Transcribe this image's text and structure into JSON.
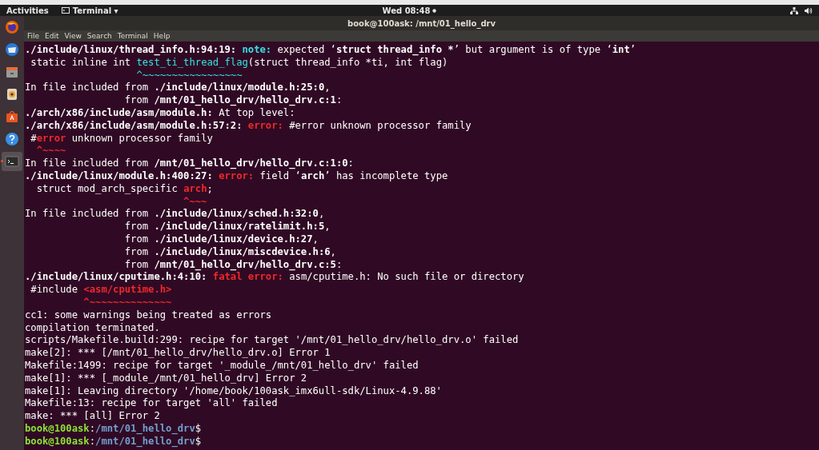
{
  "top_bar": {
    "activities": "Activities",
    "app_menu": "Terminal ▾",
    "clock": "Wed 08:48"
  },
  "dock": {
    "items": [
      {
        "kind": "firefox",
        "selected": false
      },
      {
        "kind": "mail",
        "selected": false
      },
      {
        "kind": "files",
        "selected": false
      },
      {
        "kind": "music",
        "selected": false
      },
      {
        "kind": "software",
        "selected": false
      },
      {
        "kind": "help",
        "selected": false
      },
      {
        "kind": "terminal",
        "selected": true
      }
    ]
  },
  "window": {
    "title": "book@100ask: /mnt/01_hello_drv"
  },
  "menu": [
    "File",
    "Edit",
    "View",
    "Search",
    "Terminal",
    "Help"
  ],
  "terminal": {
    "lines": [
      [
        {
          "text": "./include/linux/thread_info.h:94:19: ",
          "kind": "bold"
        },
        {
          "text": "note:",
          "kind": "note"
        },
        {
          "text": " expected ‘",
          "kind": "plain"
        },
        {
          "text": "struct thread_info *",
          "kind": "bold"
        },
        {
          "text": "’ but argument is of type ‘",
          "kind": "plain"
        },
        {
          "text": "int",
          "kind": "bold"
        },
        {
          "text": "’",
          "kind": "plain"
        }
      ],
      [
        {
          "text": " static inline int ",
          "kind": "plain"
        },
        {
          "text": "test_ti_thread_flag",
          "kind": "cyan"
        },
        {
          "text": "(struct thread_info *ti, int flag)",
          "kind": "plain"
        }
      ],
      [
        {
          "text": "                   ^~~~~~~~~~~~~~~~~~",
          "kind": "cyan"
        }
      ],
      [
        {
          "text": "In file included from ",
          "kind": "plain"
        },
        {
          "text": "./include/linux/module.h:25:0",
          "kind": "bold"
        },
        {
          "text": ",",
          "kind": "plain"
        }
      ],
      [
        {
          "text": "                 from ",
          "kind": "plain"
        },
        {
          "text": "/mnt/01_hello_drv/hello_drv.c:1",
          "kind": "bold"
        },
        {
          "text": ":",
          "kind": "plain"
        }
      ],
      [
        {
          "text": "./arch/x86/include/asm/module.h:",
          "kind": "bold"
        },
        {
          "text": " At top level:",
          "kind": "plain"
        }
      ],
      [
        {
          "text": "./arch/x86/include/asm/module.h:57:2: ",
          "kind": "bold"
        },
        {
          "text": "error:",
          "kind": "error"
        },
        {
          "text": " #error unknown processor family",
          "kind": "plain"
        }
      ],
      [
        {
          "text": " #",
          "kind": "plain"
        },
        {
          "text": "error",
          "kind": "error"
        },
        {
          "text": " unknown processor family",
          "kind": "plain"
        }
      ],
      [
        {
          "text": "  ^~~~~",
          "kind": "error"
        }
      ],
      [
        {
          "text": "In file included from ",
          "kind": "plain"
        },
        {
          "text": "/mnt/01_hello_drv/hello_drv.c:1:0",
          "kind": "bold"
        },
        {
          "text": ":",
          "kind": "plain"
        }
      ],
      [
        {
          "text": "./include/linux/module.h:400:27: ",
          "kind": "bold"
        },
        {
          "text": "error:",
          "kind": "error"
        },
        {
          "text": " field ‘",
          "kind": "plain"
        },
        {
          "text": "arch",
          "kind": "bold"
        },
        {
          "text": "’ has incomplete type",
          "kind": "plain"
        }
      ],
      [
        {
          "text": "  struct mod_arch_specific ",
          "kind": "plain"
        },
        {
          "text": "arch",
          "kind": "error"
        },
        {
          "text": ";",
          "kind": "plain"
        }
      ],
      [
        {
          "text": "                           ^~~~",
          "kind": "error"
        }
      ],
      [
        {
          "text": "In file included from ",
          "kind": "plain"
        },
        {
          "text": "./include/linux/sched.h:32:0",
          "kind": "bold"
        },
        {
          "text": ",",
          "kind": "plain"
        }
      ],
      [
        {
          "text": "                 from ",
          "kind": "plain"
        },
        {
          "text": "./include/linux/ratelimit.h:5",
          "kind": "bold"
        },
        {
          "text": ",",
          "kind": "plain"
        }
      ],
      [
        {
          "text": "                 from ",
          "kind": "plain"
        },
        {
          "text": "./include/linux/device.h:27",
          "kind": "bold"
        },
        {
          "text": ",",
          "kind": "plain"
        }
      ],
      [
        {
          "text": "                 from ",
          "kind": "plain"
        },
        {
          "text": "./include/linux/miscdevice.h:6",
          "kind": "bold"
        },
        {
          "text": ",",
          "kind": "plain"
        }
      ],
      [
        {
          "text": "                 from ",
          "kind": "plain"
        },
        {
          "text": "/mnt/01_hello_drv/hello_drv.c:5",
          "kind": "bold"
        },
        {
          "text": ":",
          "kind": "plain"
        }
      ],
      [
        {
          "text": "./include/linux/cputime.h:4:10: ",
          "kind": "bold"
        },
        {
          "text": "fatal error:",
          "kind": "error"
        },
        {
          "text": " asm/cputime.h: No such file or directory",
          "kind": "plain"
        }
      ],
      [
        {
          "text": " #include ",
          "kind": "plain"
        },
        {
          "text": "<asm/cputime.h>",
          "kind": "error"
        }
      ],
      [
        {
          "text": "          ^~~~~~~~~~~~~~~",
          "kind": "error"
        }
      ],
      [
        {
          "text": "cc1: some warnings being treated as errors",
          "kind": "plain"
        }
      ],
      [
        {
          "text": "compilation terminated.",
          "kind": "plain"
        }
      ],
      [
        {
          "text": "scripts/Makefile.build:299: recipe for target '/mnt/01_hello_drv/hello_drv.o' failed",
          "kind": "plain"
        }
      ],
      [
        {
          "text": "make[2]: *** [/mnt/01_hello_drv/hello_drv.o] Error 1",
          "kind": "plain"
        }
      ],
      [
        {
          "text": "Makefile:1499: recipe for target '_module_/mnt/01_hello_drv' failed",
          "kind": "plain"
        }
      ],
      [
        {
          "text": "make[1]: *** [_module_/mnt/01_hello_drv] Error 2",
          "kind": "plain"
        }
      ],
      [
        {
          "text": "make[1]: Leaving directory '/home/book/100ask_imx6ull-sdk/Linux-4.9.88'",
          "kind": "plain"
        }
      ],
      [
        {
          "text": "Makefile:13: recipe for target 'all' failed",
          "kind": "plain"
        }
      ],
      [
        {
          "text": "make: *** [all] Error 2",
          "kind": "plain"
        }
      ],
      [
        {
          "text": "book@100ask",
          "kind": "user"
        },
        {
          "text": ":",
          "kind": "plain"
        },
        {
          "text": "/mnt/01_hello_drv",
          "kind": "path"
        },
        {
          "text": "$",
          "kind": "plain"
        }
      ],
      [
        {
          "text": "book@100ask",
          "kind": "user"
        },
        {
          "text": ":",
          "kind": "plain"
        },
        {
          "text": "/mnt/01_hello_drv",
          "kind": "path"
        },
        {
          "text": "$",
          "kind": "plain"
        }
      ]
    ]
  }
}
